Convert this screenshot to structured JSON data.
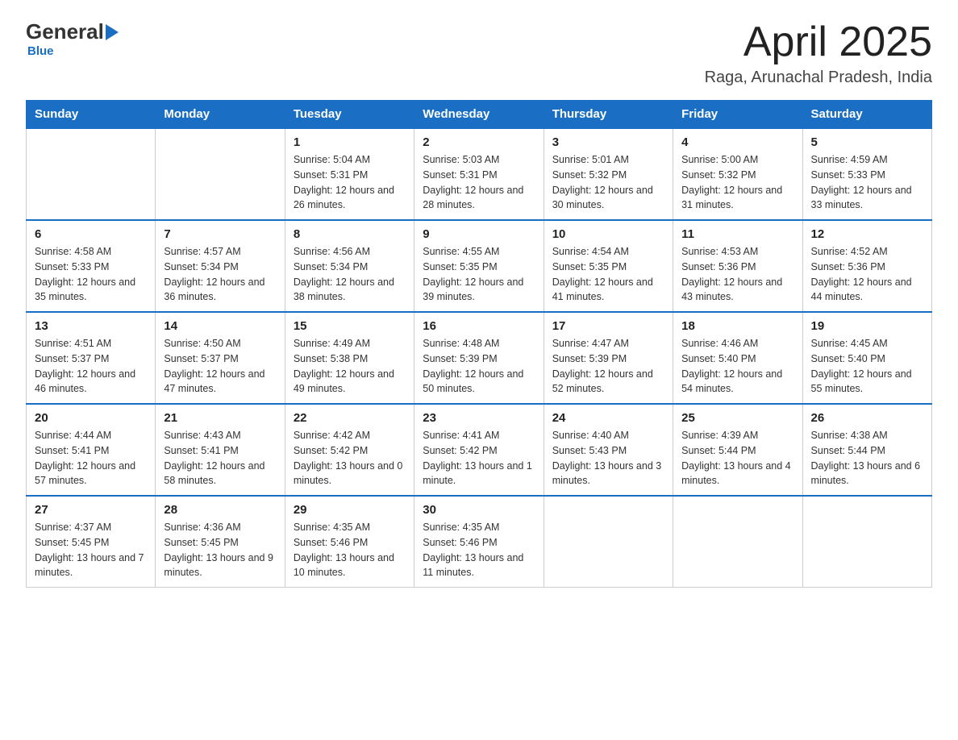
{
  "header": {
    "title": "April 2025",
    "subtitle": "Raga, Arunachal Pradesh, India"
  },
  "logo": {
    "general": "General",
    "blue": "Blue"
  },
  "days": [
    "Sunday",
    "Monday",
    "Tuesday",
    "Wednesday",
    "Thursday",
    "Friday",
    "Saturday"
  ],
  "weeks": [
    [
      {
        "day": "",
        "sunrise": "",
        "sunset": "",
        "daylight": ""
      },
      {
        "day": "",
        "sunrise": "",
        "sunset": "",
        "daylight": ""
      },
      {
        "day": "1",
        "sunrise": "Sunrise: 5:04 AM",
        "sunset": "Sunset: 5:31 PM",
        "daylight": "Daylight: 12 hours and 26 minutes."
      },
      {
        "day": "2",
        "sunrise": "Sunrise: 5:03 AM",
        "sunset": "Sunset: 5:31 PM",
        "daylight": "Daylight: 12 hours and 28 minutes."
      },
      {
        "day": "3",
        "sunrise": "Sunrise: 5:01 AM",
        "sunset": "Sunset: 5:32 PM",
        "daylight": "Daylight: 12 hours and 30 minutes."
      },
      {
        "day": "4",
        "sunrise": "Sunrise: 5:00 AM",
        "sunset": "Sunset: 5:32 PM",
        "daylight": "Daylight: 12 hours and 31 minutes."
      },
      {
        "day": "5",
        "sunrise": "Sunrise: 4:59 AM",
        "sunset": "Sunset: 5:33 PM",
        "daylight": "Daylight: 12 hours and 33 minutes."
      }
    ],
    [
      {
        "day": "6",
        "sunrise": "Sunrise: 4:58 AM",
        "sunset": "Sunset: 5:33 PM",
        "daylight": "Daylight: 12 hours and 35 minutes."
      },
      {
        "day": "7",
        "sunrise": "Sunrise: 4:57 AM",
        "sunset": "Sunset: 5:34 PM",
        "daylight": "Daylight: 12 hours and 36 minutes."
      },
      {
        "day": "8",
        "sunrise": "Sunrise: 4:56 AM",
        "sunset": "Sunset: 5:34 PM",
        "daylight": "Daylight: 12 hours and 38 minutes."
      },
      {
        "day": "9",
        "sunrise": "Sunrise: 4:55 AM",
        "sunset": "Sunset: 5:35 PM",
        "daylight": "Daylight: 12 hours and 39 minutes."
      },
      {
        "day": "10",
        "sunrise": "Sunrise: 4:54 AM",
        "sunset": "Sunset: 5:35 PM",
        "daylight": "Daylight: 12 hours and 41 minutes."
      },
      {
        "day": "11",
        "sunrise": "Sunrise: 4:53 AM",
        "sunset": "Sunset: 5:36 PM",
        "daylight": "Daylight: 12 hours and 43 minutes."
      },
      {
        "day": "12",
        "sunrise": "Sunrise: 4:52 AM",
        "sunset": "Sunset: 5:36 PM",
        "daylight": "Daylight: 12 hours and 44 minutes."
      }
    ],
    [
      {
        "day": "13",
        "sunrise": "Sunrise: 4:51 AM",
        "sunset": "Sunset: 5:37 PM",
        "daylight": "Daylight: 12 hours and 46 minutes."
      },
      {
        "day": "14",
        "sunrise": "Sunrise: 4:50 AM",
        "sunset": "Sunset: 5:37 PM",
        "daylight": "Daylight: 12 hours and 47 minutes."
      },
      {
        "day": "15",
        "sunrise": "Sunrise: 4:49 AM",
        "sunset": "Sunset: 5:38 PM",
        "daylight": "Daylight: 12 hours and 49 minutes."
      },
      {
        "day": "16",
        "sunrise": "Sunrise: 4:48 AM",
        "sunset": "Sunset: 5:39 PM",
        "daylight": "Daylight: 12 hours and 50 minutes."
      },
      {
        "day": "17",
        "sunrise": "Sunrise: 4:47 AM",
        "sunset": "Sunset: 5:39 PM",
        "daylight": "Daylight: 12 hours and 52 minutes."
      },
      {
        "day": "18",
        "sunrise": "Sunrise: 4:46 AM",
        "sunset": "Sunset: 5:40 PM",
        "daylight": "Daylight: 12 hours and 54 minutes."
      },
      {
        "day": "19",
        "sunrise": "Sunrise: 4:45 AM",
        "sunset": "Sunset: 5:40 PM",
        "daylight": "Daylight: 12 hours and 55 minutes."
      }
    ],
    [
      {
        "day": "20",
        "sunrise": "Sunrise: 4:44 AM",
        "sunset": "Sunset: 5:41 PM",
        "daylight": "Daylight: 12 hours and 57 minutes."
      },
      {
        "day": "21",
        "sunrise": "Sunrise: 4:43 AM",
        "sunset": "Sunset: 5:41 PM",
        "daylight": "Daylight: 12 hours and 58 minutes."
      },
      {
        "day": "22",
        "sunrise": "Sunrise: 4:42 AM",
        "sunset": "Sunset: 5:42 PM",
        "daylight": "Daylight: 13 hours and 0 minutes."
      },
      {
        "day": "23",
        "sunrise": "Sunrise: 4:41 AM",
        "sunset": "Sunset: 5:42 PM",
        "daylight": "Daylight: 13 hours and 1 minute."
      },
      {
        "day": "24",
        "sunrise": "Sunrise: 4:40 AM",
        "sunset": "Sunset: 5:43 PM",
        "daylight": "Daylight: 13 hours and 3 minutes."
      },
      {
        "day": "25",
        "sunrise": "Sunrise: 4:39 AM",
        "sunset": "Sunset: 5:44 PM",
        "daylight": "Daylight: 13 hours and 4 minutes."
      },
      {
        "day": "26",
        "sunrise": "Sunrise: 4:38 AM",
        "sunset": "Sunset: 5:44 PM",
        "daylight": "Daylight: 13 hours and 6 minutes."
      }
    ],
    [
      {
        "day": "27",
        "sunrise": "Sunrise: 4:37 AM",
        "sunset": "Sunset: 5:45 PM",
        "daylight": "Daylight: 13 hours and 7 minutes."
      },
      {
        "day": "28",
        "sunrise": "Sunrise: 4:36 AM",
        "sunset": "Sunset: 5:45 PM",
        "daylight": "Daylight: 13 hours and 9 minutes."
      },
      {
        "day": "29",
        "sunrise": "Sunrise: 4:35 AM",
        "sunset": "Sunset: 5:46 PM",
        "daylight": "Daylight: 13 hours and 10 minutes."
      },
      {
        "day": "30",
        "sunrise": "Sunrise: 4:35 AM",
        "sunset": "Sunset: 5:46 PM",
        "daylight": "Daylight: 13 hours and 11 minutes."
      },
      {
        "day": "",
        "sunrise": "",
        "sunset": "",
        "daylight": ""
      },
      {
        "day": "",
        "sunrise": "",
        "sunset": "",
        "daylight": ""
      },
      {
        "day": "",
        "sunrise": "",
        "sunset": "",
        "daylight": ""
      }
    ]
  ]
}
